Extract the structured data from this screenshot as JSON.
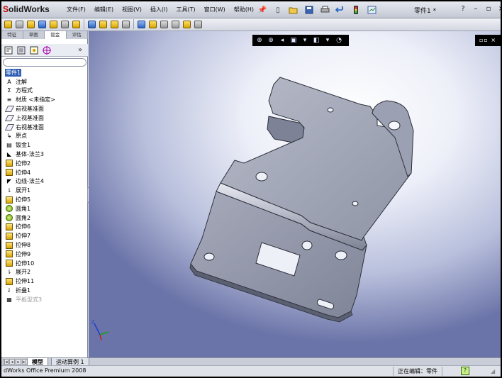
{
  "app": {
    "logo_prefix": "S",
    "logo_rest": "olidWorks",
    "document_title": "零件1 *"
  },
  "menu": [
    "文件(F)",
    "编辑(E)",
    "视图(V)",
    "插入(I)",
    "工具(T)",
    "窗口(W)",
    "帮助(H)"
  ],
  "window_controls": {
    "help": "?",
    "minimize": "–",
    "restore": "▫",
    "close": "×"
  },
  "command_tabs": [
    "特征",
    "草图",
    "钣金",
    "评估"
  ],
  "command_tabs_active": 2,
  "panel_expand": "»",
  "tree": {
    "root": "零件1",
    "items": [
      {
        "label": "注解",
        "icon": "annotation-icon",
        "glyph": "A"
      },
      {
        "label": "方程式",
        "icon": "equation-icon",
        "glyph": "Σ"
      },
      {
        "label": "材质 <未指定>",
        "icon": "material-icon",
        "glyph": "≡"
      },
      {
        "label": "前视基准面",
        "icon": "plane-icon",
        "glyph": ""
      },
      {
        "label": "上视基准面",
        "icon": "plane-icon",
        "glyph": ""
      },
      {
        "label": "右视基准面",
        "icon": "plane-icon",
        "glyph": ""
      },
      {
        "label": "原点",
        "icon": "origin-icon",
        "glyph": "↳"
      },
      {
        "label": "钣金1",
        "icon": "sheet-metal-icon",
        "glyph": "▤"
      },
      {
        "label": "基体-法兰3",
        "icon": "base-flange-icon",
        "glyph": "◣"
      },
      {
        "label": "拉伸2",
        "icon": "extrude-icon",
        "glyph": ""
      },
      {
        "label": "拉伸4",
        "icon": "extrude-icon",
        "glyph": ""
      },
      {
        "label": "边线-法兰4",
        "icon": "edge-flange-icon",
        "glyph": "◤"
      },
      {
        "label": "展开1",
        "icon": "unfold-icon",
        "glyph": "⇂"
      },
      {
        "label": "拉伸5",
        "icon": "extrude-icon",
        "glyph": ""
      },
      {
        "label": "圆角1",
        "icon": "fillet-icon",
        "glyph": ""
      },
      {
        "label": "圆角2",
        "icon": "fillet-icon",
        "glyph": ""
      },
      {
        "label": "拉伸6",
        "icon": "extrude-icon",
        "glyph": ""
      },
      {
        "label": "拉伸7",
        "icon": "extrude-icon",
        "glyph": ""
      },
      {
        "label": "拉伸8",
        "icon": "extrude-icon",
        "glyph": ""
      },
      {
        "label": "拉伸9",
        "icon": "extrude-icon",
        "glyph": ""
      },
      {
        "label": "拉伸10",
        "icon": "extrude-icon",
        "glyph": ""
      },
      {
        "label": "展开2",
        "icon": "unfold-icon",
        "glyph": "⇂"
      },
      {
        "label": "拉伸11",
        "icon": "extrude-icon",
        "glyph": ""
      },
      {
        "label": "折叠1",
        "icon": "fold-icon",
        "glyph": "⇃"
      },
      {
        "label": "平板型式3",
        "icon": "flat-pattern-icon",
        "glyph": "▦",
        "suppressed": true
      }
    ]
  },
  "bottom_tabs": {
    "model": "模型",
    "motion": "运动算例 1"
  },
  "status": {
    "product": "dWorks Office Premium 2008",
    "editing": "正在编辑：零件",
    "help": "?"
  },
  "viewport_corner": "▫▫ ×",
  "colors": {
    "accent": "#2f5fb3",
    "part_face": "#9a9fb0",
    "part_edge": "#2c2f3a"
  }
}
